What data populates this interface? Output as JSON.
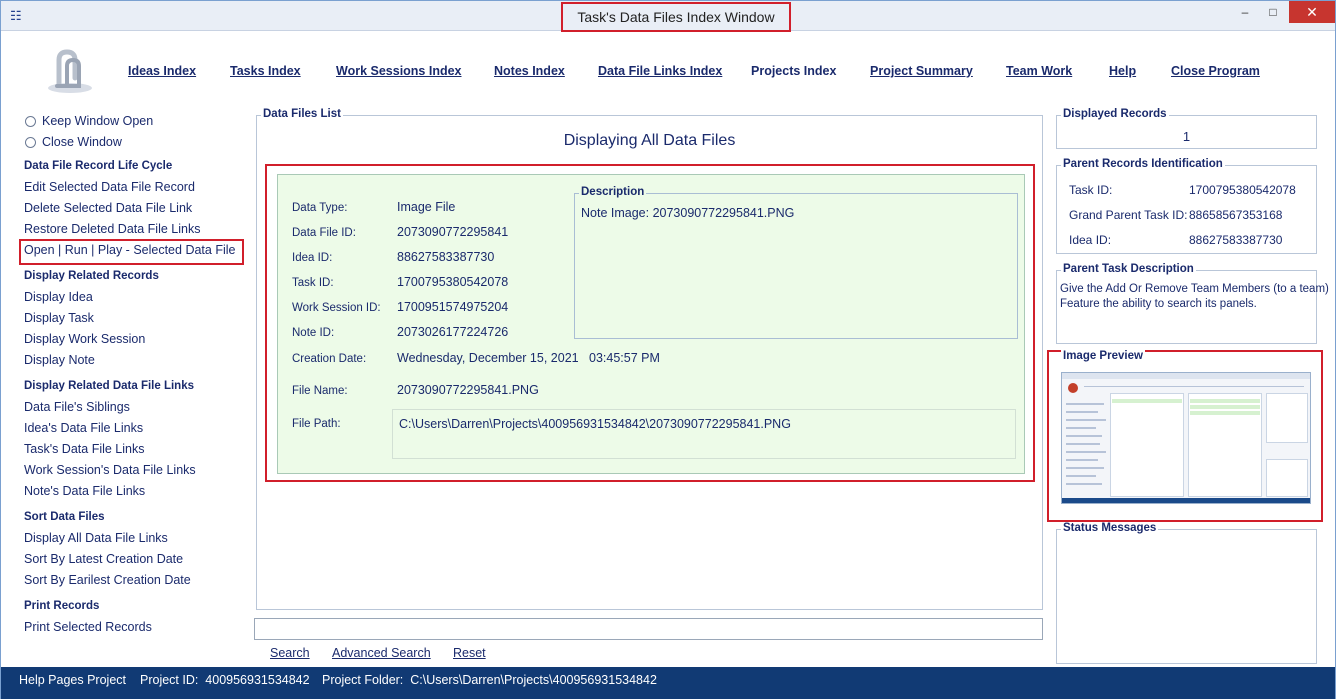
{
  "window": {
    "title": "Task's Data Files Index Window"
  },
  "topnav": [
    "Ideas Index",
    "Tasks Index",
    "Work Sessions Index",
    "Notes Index",
    "Data File Links Index",
    "Projects Index",
    "Project Summary",
    "Team Work",
    "Help",
    "Close Program"
  ],
  "sidebar": {
    "keep_open": "Keep Window Open",
    "close_window": "Close Window",
    "lifecycle_head": "Data File Record Life Cycle",
    "edit": "Edit Selected Data File Record",
    "delete": "Delete Selected Data File Link",
    "restore": "Restore Deleted Data File Links",
    "open": "Open | Run | Play - Selected Data File",
    "related_head": "Display Related Records",
    "display_idea": "Display Idea",
    "display_task": "Display Task",
    "display_session": "Display Work Session",
    "display_note": "Display Note",
    "related_links_head": "Display Related Data File Links",
    "siblings": "Data File's Siblings",
    "idea_links": "Idea's Data File Links",
    "task_links": "Task's Data File Links",
    "session_links": "Work Session's Data File Links",
    "note_links": "Note's Data File Links",
    "sort_head": "Sort Data Files",
    "display_all": "Display All Data File Links",
    "sort_latest": "Sort By Latest Creation Date",
    "sort_earliest": "Sort By Earilest Creation Date",
    "print_head": "Print Records",
    "print_selected": "Print Selected Records"
  },
  "main": {
    "legend": "Data Files List",
    "title": "Displaying All Data Files",
    "fields": {
      "data_type_label": "Data Type:",
      "data_type": "Image File",
      "file_id_label": "Data File ID:",
      "file_id": "2073090772295841",
      "idea_id_label": "Idea ID:",
      "idea_id": "88627583387730",
      "task_id_label": "Task ID:",
      "task_id": "1700795380542078",
      "session_id_label": "Work Session ID:",
      "session_id": "1700951574975204",
      "note_id_label": "Note ID:",
      "note_id": "2073026177224726",
      "creation_label": "Creation Date:",
      "creation": "Wednesday, December 15, 2021   03:45:57 PM",
      "file_name_label": "File Name:",
      "file_name": "2073090772295841.PNG",
      "file_path_label": "File Path:",
      "file_path": "C:\\Users\\Darren\\Projects\\400956931534842\\2073090772295841.PNG"
    },
    "description_legend": "Description",
    "description": "Note Image: 2073090772295841.PNG"
  },
  "search": {
    "search": "Search",
    "advanced": "Advanced Search",
    "reset": "Reset"
  },
  "right": {
    "displayed_legend": "Displayed Records",
    "displayed_count": "1",
    "parent_legend": "Parent Records Identification",
    "task_id_label": "Task ID:",
    "task_id": "1700795380542078",
    "grand_parent_label": "Grand Parent Task ID:",
    "grand_parent": "88658567353168",
    "idea_id_label": "Idea ID:",
    "idea_id": "88627583387730",
    "parent_desc_legend": "Parent Task Description",
    "parent_desc_line1": "Give the Add Or Remove Team Members (to a team)",
    "parent_desc_line2": "Feature the ability to search its panels.",
    "preview_legend": "Image Preview",
    "status_legend": "Status Messages"
  },
  "statusbar": {
    "project": "Help Pages Project",
    "project_id": "Project ID:  400956931534842",
    "project_folder": "Project Folder:  C:\\Users\\Darren\\Projects\\400956931534842"
  }
}
